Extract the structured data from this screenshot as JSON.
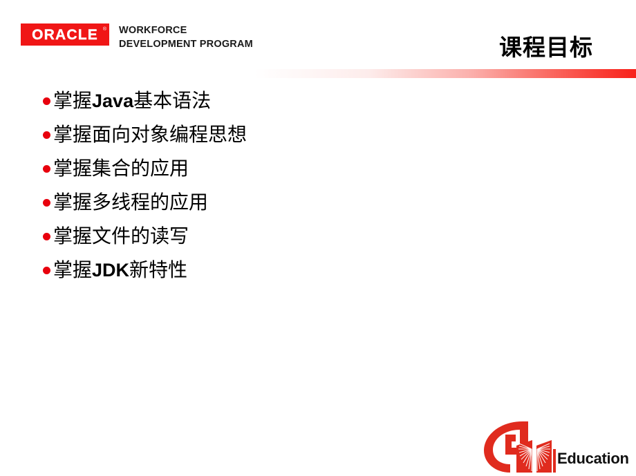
{
  "header": {
    "oracle_logo_text": "ORACLE",
    "oracle_registered_mark": "®",
    "program_line1": "WORKFORCE",
    "program_line2": "DEVELOPMENT PROGRAM",
    "slide_title": "课程目标"
  },
  "content": {
    "bullets": [
      {
        "prefix": "掌握",
        "emphasis": "Java",
        "suffix": "基本语法",
        "full": "掌握Java基本语法"
      },
      {
        "prefix": "掌握面向对象编程思想",
        "emphasis": "",
        "suffix": "",
        "full": "掌握面向对象编程思想"
      },
      {
        "prefix": "掌握集合的应用",
        "emphasis": "",
        "suffix": "",
        "full": "掌握集合的应用"
      },
      {
        "prefix": "掌握多线程的应用",
        "emphasis": "",
        "suffix": "",
        "full": "掌握多线程的应用"
      },
      {
        "prefix": "掌握文件的读写",
        "emphasis": "",
        "suffix": "",
        "full": "掌握文件的读写"
      },
      {
        "prefix": "掌握",
        "emphasis": "JDK",
        "suffix": "新特性",
        "full": "掌握JDK新特性"
      }
    ]
  },
  "footer": {
    "education_label": "Education"
  },
  "colors": {
    "oracle_red": "#F01616",
    "bullet_red": "#E8000D",
    "rule_red": "#F8211B",
    "logo_red": "#E02B1E",
    "text_black": "#000000",
    "background": "#FFFFFF"
  }
}
